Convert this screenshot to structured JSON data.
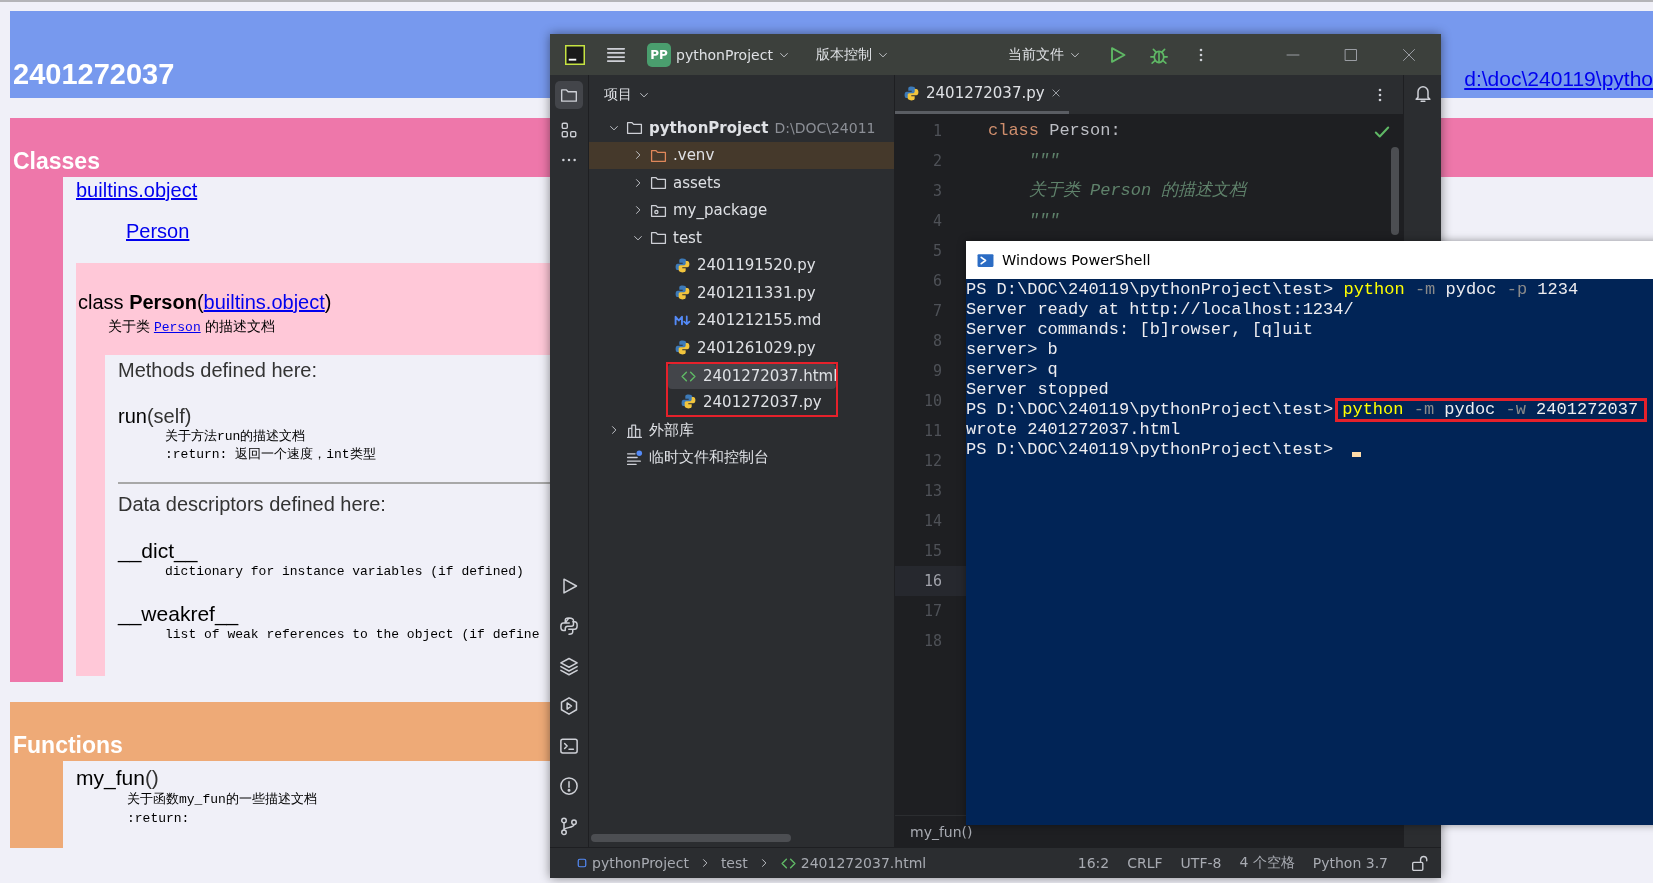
{
  "pydoc_page": {
    "title": "2401272037",
    "file_link": "d:\\doc\\240119\\pytho",
    "classes": {
      "heading": "Classes",
      "tree": [
        {
          "label": "builtins.object",
          "children": [
            {
              "label": "Person"
            }
          ]
        }
      ],
      "class_block": {
        "signature_prefix": "class **Person**(",
        "base": "builtins.object",
        "signature_suffix": ")",
        "doc_before": "关于类 ",
        "doc_link": "Person",
        "doc_after": " 的描述文档",
        "methods_heading": "Methods defined here:",
        "methods": [
          {
            "name": "run",
            "args": "(self)",
            "doc": [
              "关于方法run的描述文档",
              ":return: 返回一个速度，int类型"
            ]
          }
        ],
        "descriptors_heading": "Data descriptors defined here:",
        "descriptors": [
          {
            "name": "__dict__",
            "doc": "dictionary for instance variables (if defined)"
          },
          {
            "name": "__weakref__",
            "doc": "list of weak references to the object (if define"
          }
        ]
      }
    },
    "functions": {
      "heading": "Functions",
      "items": [
        {
          "name": "my_fun",
          "args": "()",
          "doc": [
            "关于函数my_fun的一些描述文档",
            ":return:"
          ]
        }
      ]
    }
  },
  "ide": {
    "title_bar": {
      "project_badge": "PP",
      "project": "pythonProject",
      "vcs": "版本控制",
      "run_config": "当前文件"
    },
    "project_panel": {
      "title": "项目",
      "tree": [
        {
          "label": "pythonProject",
          "path": "D:\\DOC\\24011",
          "kind": "project_root",
          "expanded": true,
          "selected": false,
          "annotated": false,
          "children": [
            {
              "label": ".venv",
              "kind": "excluded_folder",
              "expanded": false,
              "selected": false,
              "annotated": false
            },
            {
              "label": "assets",
              "kind": "folder",
              "expanded": false,
              "selected": false,
              "annotated": false
            },
            {
              "label": "my_package",
              "kind": "package",
              "expanded": false,
              "selected": false,
              "annotated": false
            },
            {
              "label": "test",
              "kind": "folder",
              "expanded": true,
              "selected": false,
              "annotated": false,
              "children": [
                {
                  "label": "2401191520.py",
                  "kind": "python_file",
                  "selected": false,
                  "annotated": false
                },
                {
                  "label": "2401211331.py",
                  "kind": "python_file",
                  "selected": false,
                  "annotated": false
                },
                {
                  "label": "2401212155.md",
                  "kind": "markdown_file",
                  "selected": false,
                  "annotated": false
                },
                {
                  "label": "2401261029.py",
                  "kind": "python_file",
                  "selected": false,
                  "annotated": false
                },
                {
                  "label": "2401272037.html",
                  "kind": "html_file",
                  "selected": true,
                  "annotated": true
                },
                {
                  "label": "2401272037.py",
                  "kind": "python_file",
                  "selected": false,
                  "annotated": true
                }
              ]
            }
          ]
        },
        {
          "label": "外部库",
          "kind": "library",
          "expanded": false,
          "selected": false,
          "annotated": false
        },
        {
          "label": "临时文件和控制台",
          "kind": "scratches",
          "selected": false,
          "annotated": false
        }
      ]
    },
    "tabs": [
      {
        "label": "2401272037.py",
        "selected": true
      }
    ],
    "editor": {
      "lines": [
        {
          "number": "1",
          "current": false,
          "segments": [
            {
              "text": "class",
              "kind": "keyword"
            },
            {
              "text": " Person:",
              "kind": "plain"
            }
          ]
        },
        {
          "number": "2",
          "current": false,
          "segments": [
            {
              "text": "    \"\"\"",
              "kind": "docstring"
            }
          ]
        },
        {
          "number": "3",
          "current": false,
          "segments": [
            {
              "text": "    关于类 Person 的描述文档",
              "kind": "doc_comment"
            }
          ]
        },
        {
          "number": "4",
          "current": false,
          "segments": [
            {
              "text": "    \"\"\"",
              "kind": "docstring"
            }
          ]
        },
        {
          "number": "5",
          "current": false
        },
        {
          "number": "6",
          "current": false
        },
        {
          "number": "7",
          "current": false
        },
        {
          "number": "8",
          "current": false
        },
        {
          "number": "9",
          "current": false
        },
        {
          "number": "10",
          "current": false
        },
        {
          "number": "11",
          "current": false
        },
        {
          "number": "12",
          "current": false
        },
        {
          "number": "13",
          "current": false
        },
        {
          "number": "14",
          "current": false
        },
        {
          "number": "15",
          "current": false
        },
        {
          "number": "16",
          "current": true
        },
        {
          "number": "17",
          "current": false
        },
        {
          "number": "18",
          "current": false
        }
      ],
      "breadcrumb": "my_fun()"
    },
    "status_bar": {
      "path": [
        {
          "label": "pythonProject",
          "kind": "module"
        },
        {
          "label": "test",
          "kind": "folder"
        },
        {
          "label": "2401272037.html",
          "kind": "html_file"
        }
      ],
      "items": [
        "16:2",
        "CRLF",
        "UTF-8",
        "4 个空格",
        "Python 3.7"
      ]
    }
  },
  "powershell": {
    "title": "Windows PowerShell",
    "lines": [
      {
        "prompt": "PS D:\\DOC\\240119\\pythonProject\\test> ",
        "segments": [
          {
            "text": "python",
            "kind": "command"
          },
          {
            "text": " -m",
            "kind": "flag"
          },
          {
            "text": " pydoc",
            "kind": "text"
          },
          {
            "text": " -p",
            "kind": "flag"
          },
          {
            "text": " 1234",
            "kind": "text"
          }
        ],
        "annotated": false,
        "cursor": false
      },
      {
        "segments": [
          {
            "text": "Server ready at http://localhost:1234/",
            "kind": "text"
          }
        ],
        "annotated": false,
        "cursor": false
      },
      {
        "segments": [
          {
            "text": "Server commands: [b]rowser, [q]uit",
            "kind": "text"
          }
        ],
        "annotated": false,
        "cursor": false
      },
      {
        "segments": [
          {
            "text": "server> b",
            "kind": "text"
          }
        ],
        "annotated": false,
        "cursor": false
      },
      {
        "segments": [
          {
            "text": "server> q",
            "kind": "text"
          }
        ],
        "annotated": false,
        "cursor": false
      },
      {
        "segments": [
          {
            "text": "Server stopped",
            "kind": "text"
          }
        ],
        "annotated": false,
        "cursor": false
      },
      {
        "prompt": "PS D:\\DOC\\240119\\pythonProject\\test>",
        "segments": [
          {
            "text": "python",
            "kind": "command"
          },
          {
            "text": " -m",
            "kind": "flag"
          },
          {
            "text": " pydoc",
            "kind": "text"
          },
          {
            "text": " -w",
            "kind": "flag"
          },
          {
            "text": " 2401272037",
            "kind": "text"
          }
        ],
        "annotated": true,
        "cursor": false
      },
      {
        "segments": [
          {
            "text": "wrote 2401272037.html",
            "kind": "text"
          }
        ],
        "annotated": false,
        "cursor": false
      },
      {
        "prompt": "PS D:\\DOC\\240119\\pythonProject\\test> ",
        "annotated": false,
        "cursor": true
      }
    ]
  }
}
